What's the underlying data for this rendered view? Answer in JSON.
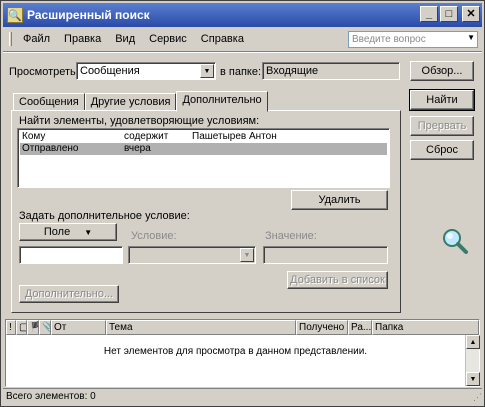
{
  "window": {
    "title": "Расширенный поиск",
    "minimize": "_",
    "maximize": "□",
    "close": "✕"
  },
  "menu": {
    "items": [
      "Файл",
      "Правка",
      "Вид",
      "Сервис",
      "Справка"
    ],
    "ask_placeholder": "Введите вопрос"
  },
  "search": {
    "look_for_label": "Просмотреть:",
    "look_for_value": "Сообщения",
    "in_folder_label": "в папке:",
    "folder_value": "Входящие",
    "browse_button": "Обзор..."
  },
  "tabs": [
    "Сообщения",
    "Другие условия",
    "Дополнительно"
  ],
  "advanced": {
    "criteria_label": "Найти элементы, удовлетворяющие условиям:",
    "criteria": [
      {
        "field": "Кому",
        "condition": "содержит",
        "value": "Пашетырев Антон"
      },
      {
        "field": "Отправлено",
        "condition": "вчера",
        "value": ""
      }
    ],
    "remove_button": "Удалить",
    "define_more_label": "Задать дополнительное условие:",
    "field_button": "Поле",
    "condition_label": "Условие:",
    "value_label": "Значение:",
    "add_to_list_button": "Добавить в список",
    "more_choices_button": "Дополнительно..."
  },
  "actions": {
    "find_now": "Найти",
    "stop": "Прервать",
    "new_search": "Сброс"
  },
  "results": {
    "columns": [
      "!",
      "▢",
      "🏴",
      "📎",
      "От",
      "Тема",
      "Получено",
      "Ра...",
      "Папка"
    ],
    "empty_message": "Нет элементов для просмотра в данном представлении."
  },
  "status": {
    "total": "Всего элементов: 0"
  }
}
